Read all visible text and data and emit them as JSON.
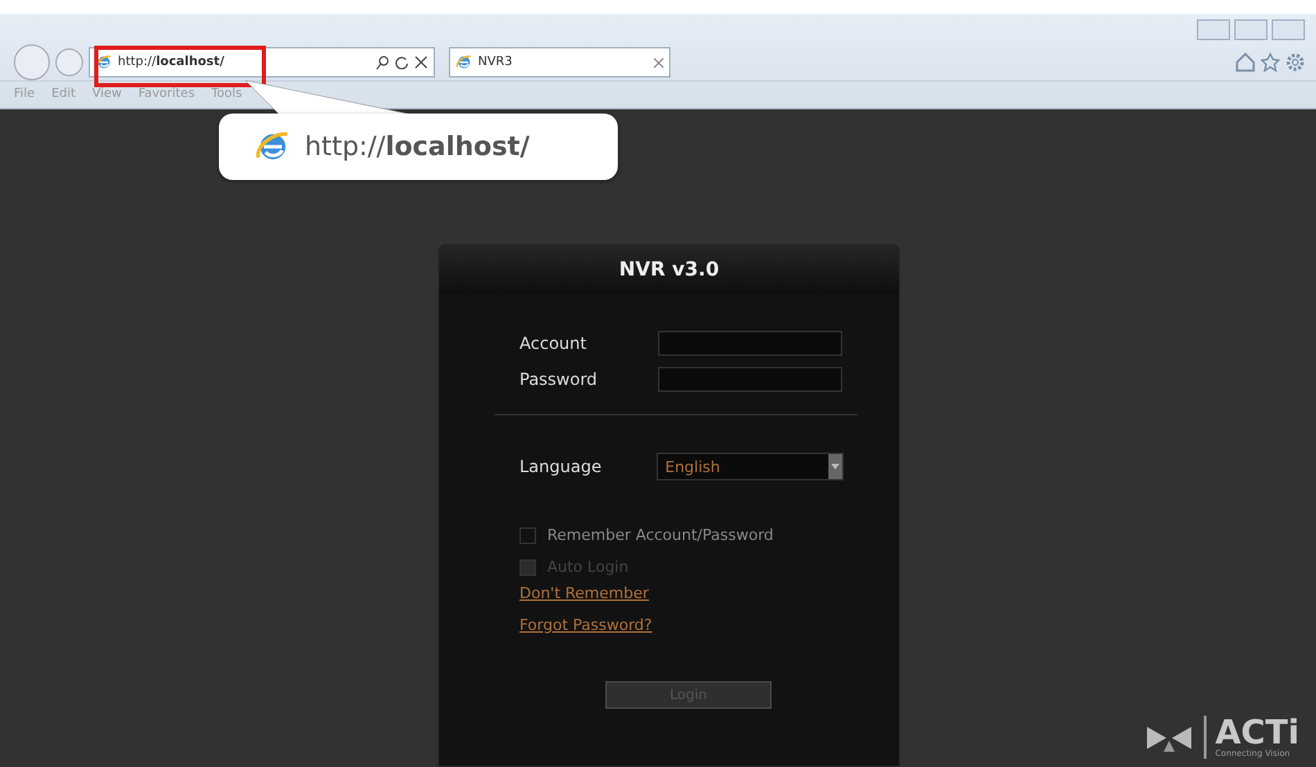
{
  "browser": {
    "address": "http://**localhost/**",
    "tab": {
      "title": "NVR3"
    },
    "menu": [
      "File",
      "Edit",
      "View",
      "Favorites",
      "Tools"
    ]
  },
  "callout": {
    "url": "http://**localhost/**"
  },
  "login": {
    "title": "NVR v3.0",
    "fields": [
      {
        "label": "Account"
      },
      {
        "label": "Password"
      }
    ],
    "language": {
      "label": "Language",
      "value": "English"
    },
    "options": [
      {
        "label": "Remember Account/Password",
        "checked": false,
        "disabled": false
      },
      {
        "label": "Auto Login",
        "checked": false,
        "disabled": true
      }
    ],
    "links": [
      "Don't Remember",
      "Forgot Password?"
    ],
    "button": {
      "label": "Login",
      "disabled": true
    }
  },
  "logo": {
    "name": "ACTi",
    "tagline": "Connecting Vision"
  }
}
